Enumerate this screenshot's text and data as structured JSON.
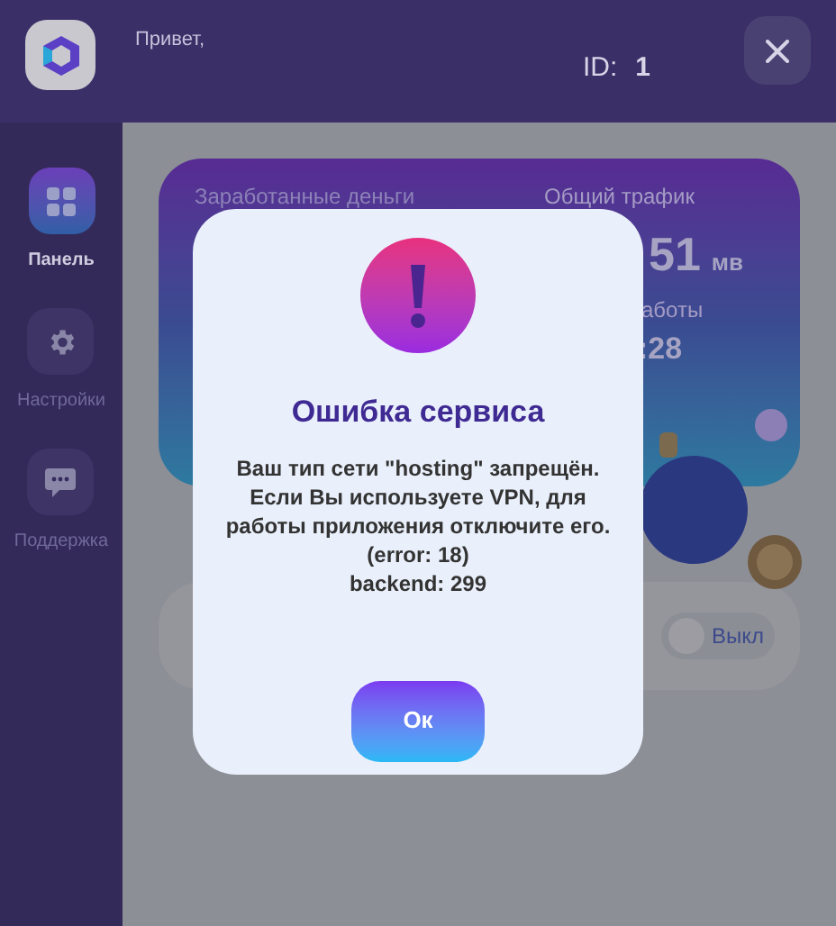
{
  "header": {
    "greeting": "Привет,",
    "id_label": "ID:",
    "id_value": "1"
  },
  "sidebar": {
    "items": [
      {
        "label": "Панель",
        "kind": "grid",
        "selected": true
      },
      {
        "label": "Настройки",
        "kind": "gear",
        "selected": false
      },
      {
        "label": "Поддержка",
        "kind": "chat",
        "selected": false
      }
    ]
  },
  "stats_card": {
    "earned_label": "Заработанные деньги",
    "traffic_label": "Общий трафик",
    "traffic_value": "51",
    "traffic_unit": "мв",
    "uptime_label": "аботы",
    "uptime_value": ":28"
  },
  "feature_card": {
    "toggle": {
      "label": "Выкл",
      "on": false
    }
  },
  "dialog": {
    "title": "Ошибка сервиса",
    "message": "Ваш тип сети \"hosting\" запрещён. Если Вы используете VPN, для работы приложения отключите его. (error: 18)",
    "detail": "backend: 299",
    "button": "Ок"
  }
}
